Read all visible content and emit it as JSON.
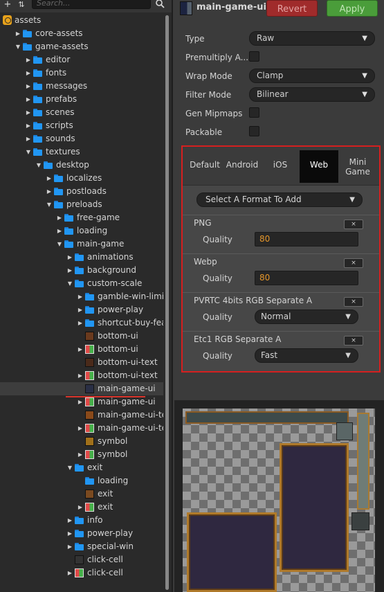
{
  "asset_panel": {
    "search_placeholder": "Search...",
    "tree": [
      {
        "label": "assets",
        "depth": 0,
        "kind": "db",
        "arrow": ""
      },
      {
        "label": "core-assets",
        "depth": 1,
        "kind": "folder",
        "arrow": "collapsed"
      },
      {
        "label": "game-assets",
        "depth": 1,
        "kind": "folder",
        "arrow": "expanded"
      },
      {
        "label": "editor",
        "depth": 2,
        "kind": "folder",
        "arrow": "collapsed"
      },
      {
        "label": "fonts",
        "depth": 2,
        "kind": "folder",
        "arrow": "collapsed"
      },
      {
        "label": "messages",
        "depth": 2,
        "kind": "folder",
        "arrow": "collapsed"
      },
      {
        "label": "prefabs",
        "depth": 2,
        "kind": "folder",
        "arrow": "collapsed"
      },
      {
        "label": "scenes",
        "depth": 2,
        "kind": "folder",
        "arrow": "collapsed"
      },
      {
        "label": "scripts",
        "depth": 2,
        "kind": "folder",
        "arrow": "collapsed"
      },
      {
        "label": "sounds",
        "depth": 2,
        "kind": "folder",
        "arrow": "collapsed"
      },
      {
        "label": "textures",
        "depth": 2,
        "kind": "folder",
        "arrow": "expanded"
      },
      {
        "label": "desktop",
        "depth": 3,
        "kind": "folder",
        "arrow": "expanded"
      },
      {
        "label": "localizes",
        "depth": 4,
        "kind": "folder",
        "arrow": "collapsed"
      },
      {
        "label": "postloads",
        "depth": 4,
        "kind": "folder",
        "arrow": "collapsed"
      },
      {
        "label": "preloads",
        "depth": 4,
        "kind": "folder",
        "arrow": "expanded"
      },
      {
        "label": "free-game",
        "depth": 5,
        "kind": "folder",
        "arrow": "collapsed"
      },
      {
        "label": "loading",
        "depth": 5,
        "kind": "folder",
        "arrow": "collapsed"
      },
      {
        "label": "main-game",
        "depth": 5,
        "kind": "folder",
        "arrow": "expanded"
      },
      {
        "label": "animations",
        "depth": 6,
        "kind": "folder",
        "arrow": "collapsed"
      },
      {
        "label": "background",
        "depth": 6,
        "kind": "folder",
        "arrow": "collapsed"
      },
      {
        "label": "custom-scale",
        "depth": 6,
        "kind": "folder",
        "arrow": "expanded"
      },
      {
        "label": "gamble-win-limit",
        "depth": 7,
        "kind": "folder",
        "arrow": "collapsed"
      },
      {
        "label": "power-play",
        "depth": 7,
        "kind": "folder",
        "arrow": "collapsed"
      },
      {
        "label": "shortcut-buy-feature",
        "depth": 7,
        "kind": "folder",
        "arrow": "collapsed"
      },
      {
        "label": "bottom-ui",
        "depth": 7,
        "kind": "texture",
        "arrow": "",
        "thumb": "#6a3a1e"
      },
      {
        "label": "bottom-ui",
        "depth": 7,
        "kind": "atlas",
        "arrow": "collapsed"
      },
      {
        "label": "bottom-ui-text",
        "depth": 7,
        "kind": "texture",
        "arrow": "",
        "thumb": "#4a2a1a"
      },
      {
        "label": "bottom-ui-text",
        "depth": 7,
        "kind": "atlas",
        "arrow": "collapsed"
      },
      {
        "label": "main-game-ui",
        "depth": 7,
        "kind": "texture",
        "arrow": "",
        "thumb": "#2a2f45",
        "selected": true
      },
      {
        "label": "main-game-ui",
        "depth": 7,
        "kind": "atlas",
        "arrow": "collapsed"
      },
      {
        "label": "main-game-ui-text",
        "depth": 7,
        "kind": "texture",
        "arrow": "",
        "thumb": "#8a4a1a"
      },
      {
        "label": "main-game-ui-text",
        "depth": 7,
        "kind": "atlas",
        "arrow": "collapsed"
      },
      {
        "label": "symbol",
        "depth": 7,
        "kind": "texture",
        "arrow": "",
        "thumb": "#a0701a"
      },
      {
        "label": "symbol",
        "depth": 7,
        "kind": "atlas",
        "arrow": "collapsed"
      },
      {
        "label": "exit",
        "depth": 6,
        "kind": "folder",
        "arrow": "expanded"
      },
      {
        "label": "loading",
        "depth": 7,
        "kind": "folder",
        "arrow": ""
      },
      {
        "label": "exit",
        "depth": 7,
        "kind": "texture",
        "arrow": "",
        "thumb": "#7a4a20"
      },
      {
        "label": "exit",
        "depth": 7,
        "kind": "atlas",
        "arrow": "collapsed"
      },
      {
        "label": "info",
        "depth": 6,
        "kind": "folder",
        "arrow": "collapsed"
      },
      {
        "label": "power-play",
        "depth": 6,
        "kind": "folder",
        "arrow": "collapsed"
      },
      {
        "label": "special-win",
        "depth": 6,
        "kind": "folder",
        "arrow": "collapsed"
      },
      {
        "label": "click-cell",
        "depth": 6,
        "kind": "texture",
        "arrow": "",
        "thumb": "#333333"
      },
      {
        "label": "click-cell",
        "depth": 6,
        "kind": "atlas",
        "arrow": "collapsed"
      }
    ]
  },
  "inspector": {
    "asset_name": "main-game-ui",
    "revert_label": "Revert",
    "apply_label": "Apply",
    "properties": {
      "type": {
        "label": "Type",
        "value": "Raw"
      },
      "premultiply": {
        "label": "Premultiply A..."
      },
      "wrap": {
        "label": "Wrap Mode",
        "value": "Clamp"
      },
      "filter": {
        "label": "Filter Mode",
        "value": "Bilinear"
      },
      "mipmaps": {
        "label": "Gen Mipmaps"
      },
      "packable": {
        "label": "Packable"
      }
    },
    "platform_tabs": [
      {
        "label": "Default"
      },
      {
        "label": "Android"
      },
      {
        "label": "iOS"
      },
      {
        "label": "Web",
        "active": true
      },
      {
        "label": "Mini Game"
      }
    ],
    "format_select": "Select A Format To Add",
    "formats": [
      {
        "name": "PNG",
        "quality_label": "Quality",
        "quality": "80",
        "control": "input"
      },
      {
        "name": "Webp",
        "quality_label": "Quality",
        "quality": "80",
        "control": "input"
      },
      {
        "name": "PVRTC 4bits RGB Separate A",
        "quality_label": "Quality",
        "quality": "Normal",
        "control": "select"
      },
      {
        "name": "Etc1 RGB Separate A",
        "quality_label": "Quality",
        "quality": "Fast",
        "control": "select"
      }
    ],
    "remove_glyph": "×"
  },
  "colors": {
    "accent_folder": "#2196f3",
    "revert": "#a02b2b",
    "apply": "#4a9d3a",
    "highlight_border": "#d51f1f",
    "quality_value": "#e5962a"
  }
}
